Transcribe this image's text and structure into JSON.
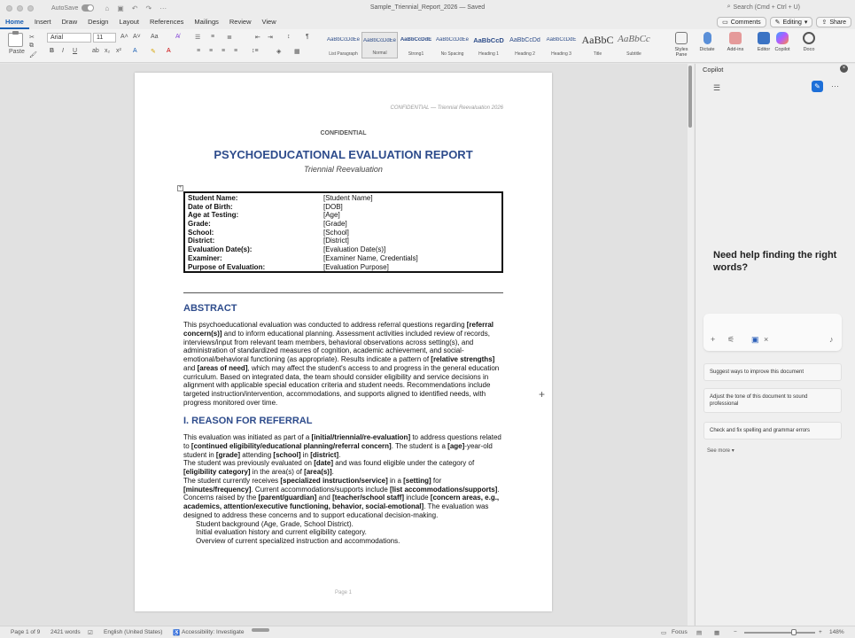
{
  "window": {
    "title": "Sample_Triennial_Report_2026 — Saved",
    "autosave_label": "AutoSave",
    "search_placeholder": "Search (Cmd + Ctrl + U)"
  },
  "tabs": [
    "Home",
    "Insert",
    "Draw",
    "Design",
    "Layout",
    "References",
    "Mailings",
    "Review",
    "View"
  ],
  "actions": {
    "comments": "Comments",
    "editing": "Editing",
    "share": "Share"
  },
  "ribbon": {
    "paste_label": "Paste",
    "font_name": "Arial",
    "font_size": "11",
    "styles": [
      {
        "preview": "AaBbCcDdEe",
        "name": "List Paragraph"
      },
      {
        "preview": "AaBbCcDdEe",
        "name": "Normal"
      },
      {
        "preview": "AaBbCcDdE",
        "name": "Strong1"
      },
      {
        "preview": "AaBbCcDdEe",
        "name": "No Spacing"
      },
      {
        "preview": "AaBbCcD",
        "name": "Heading 1"
      },
      {
        "preview": "AaBbCcDd",
        "name": "Heading 2"
      },
      {
        "preview": "AaBbCcDdE",
        "name": "Heading 3"
      },
      {
        "preview": "AaBbC",
        "name": "Title"
      },
      {
        "preview": "AaBbCc",
        "name": "Subtitle"
      }
    ],
    "styles_pane": "Styles Pane",
    "dictate": "Dictate",
    "addins": "Add-ins",
    "editor": "Editor",
    "copilot": "Copilot",
    "docu": "Doco"
  },
  "document": {
    "header_text": "CONFIDENTIAL — Triennial Reevaluation 2026",
    "confidential": "CONFIDENTIAL",
    "title": "PSYCHOEDUCATIONAL EVALUATION REPORT",
    "subtitle": "Triennial Reevaluation",
    "info_rows": [
      {
        "label": "Student Name:",
        "value": "[Student Name]"
      },
      {
        "label": "Date of Birth:",
        "value": "[DOB]"
      },
      {
        "label": "Age at Testing:",
        "value": "[Age]"
      },
      {
        "label": "Grade:",
        "value": "[Grade]"
      },
      {
        "label": "School:",
        "value": "[School]"
      },
      {
        "label": "District:",
        "value": "[District]"
      },
      {
        "label": "Evaluation Date(s):",
        "value": "[Evaluation Date(s)]"
      },
      {
        "label": "Examiner:",
        "value": "[Examiner Name, Credentials]"
      },
      {
        "label": "Purpose of Evaluation:",
        "value": "[Evaluation Purpose]"
      }
    ],
    "abstract_heading": "ABSTRACT",
    "abstract": {
      "t1": "This psychoeducational evaluation was conducted to address referral questions regarding ",
      "b1": "[referral concern(s)]",
      "t2": " and to inform educational planning. Assessment activities included review of records, interviews/input from relevant team members, behavioral observations across setting(s), and administration of standardized measures of cognition, academic achievement, and social-emotional/behavioral functioning (as appropriate). Results indicate a pattern of ",
      "b2": "[relative strengths]",
      "t3": " and ",
      "b3": "[areas of need]",
      "t4": ", which may affect the student's access to and progress in the general education curriculum. Based on integrated data, the team should consider eligibility and service decisions in alignment with applicable special education criteria and student needs. Recommendations include targeted instruction/intervention, accommodations, and supports aligned to identified needs, with progress monitored over time."
    },
    "reason_heading": "I. REASON FOR REFERRAL",
    "reason": {
      "p1_t1": "This evaluation was initiated as part of a ",
      "p1_b1": "[initial/triennial/re-evaluation]",
      "p1_t2": " to address questions related to ",
      "p1_b2": "[continued eligibility/educational planning/referral concern]",
      "p1_t3": ". The student is a ",
      "p1_b3": "[age]",
      "p1_t4": "-year-old student in ",
      "p1_b4": "[grade]",
      "p1_t5": " attending ",
      "p1_b5": "[school]",
      "p1_t6": " in ",
      "p1_b6": "[district]",
      "p1_t7": ".",
      "p2_t1": "The student was previously evaluated on ",
      "p2_b1": "[date]",
      "p2_t2": " and was found eligible under the category of ",
      "p2_b2": "[eligibility category]",
      "p2_t3": " in the area(s) of ",
      "p2_b3": "[area(s)]",
      "p2_t4": ".",
      "p3_t1": "The student currently receives ",
      "p3_b1": "[specialized instruction/service]",
      "p3_t2": " in a ",
      "p3_b2": "[setting]",
      "p3_t3": " for ",
      "p3_b3": "[minutes/frequency]",
      "p3_t4": ". Current accommodations/supports include ",
      "p3_b4": "[list accommodations/supports]",
      "p3_t5": ".",
      "p4_t1": "Concerns raised by the ",
      "p4_b1": "[parent/guardian]",
      "p4_t2": " and ",
      "p4_b2": "[teacher/school staff]",
      "p4_t3": " include ",
      "p4_b3": "[concern areas, e.g., academics, attention/executive functioning, behavior, social-emotional]",
      "p4_t4": ". The evaluation was designed to address these concerns and to support educational decision-making.",
      "list": [
        "Student background (Age, Grade, School District).",
        "Initial evaluation history and current eligibility category.",
        "Overview of current specialized instruction and accommodations."
      ]
    },
    "footer": "Page 1"
  },
  "copilot": {
    "title": "Copilot",
    "help_text": "Need help finding the right words?",
    "suggestions": [
      "Suggest ways to improve this document",
      "Adjust the tone of this document to sound professional",
      "Check and fix spelling and grammar errors"
    ],
    "see_more": "See more"
  },
  "status": {
    "page": "Page 1 of 9",
    "words": "2421 words",
    "language": "English (United States)",
    "accessibility": "Accessibility: Investigate",
    "focus": "Focus",
    "zoom": "148%"
  }
}
